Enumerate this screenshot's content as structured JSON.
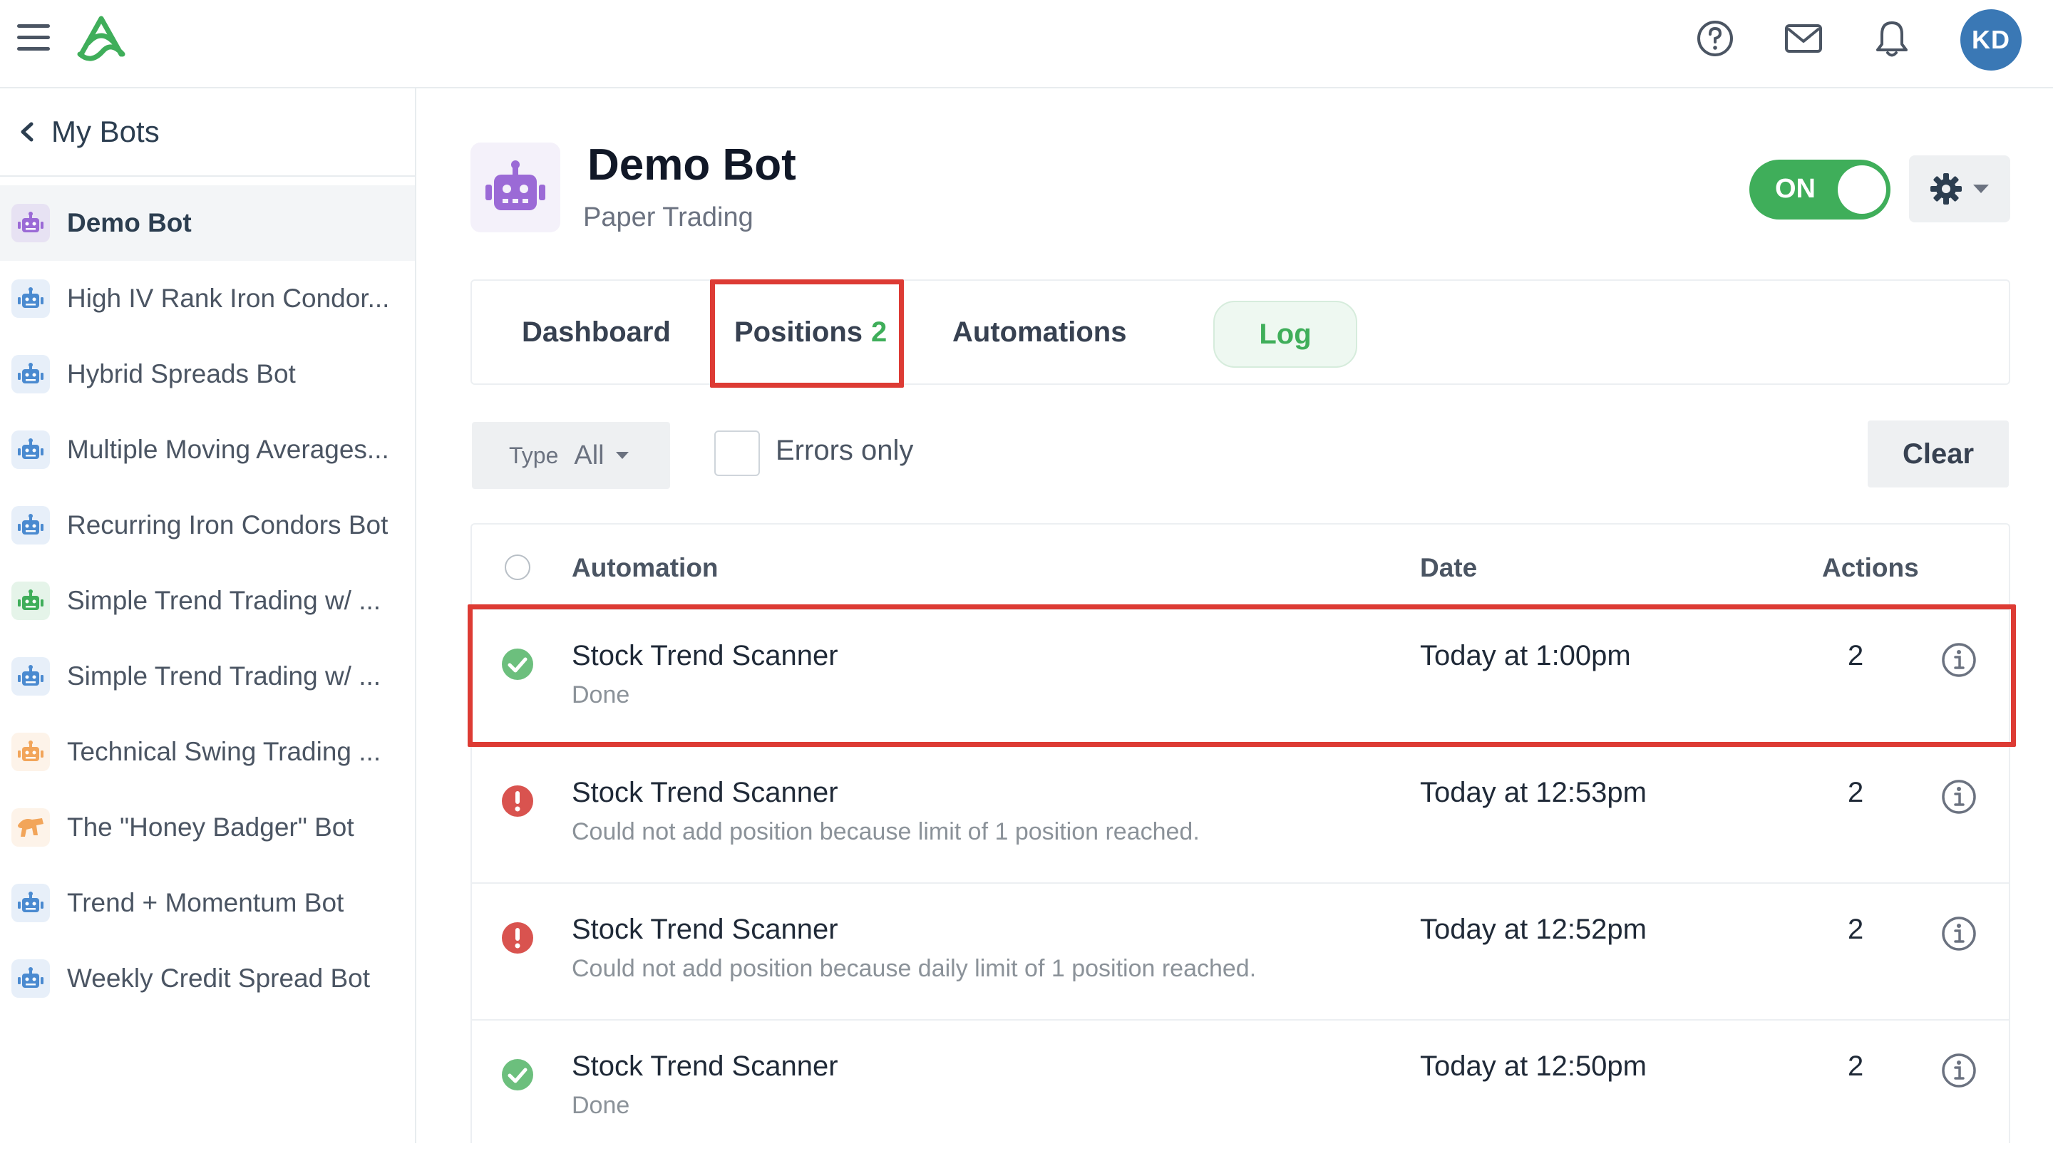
{
  "user": {
    "initials": "KD"
  },
  "sidebar": {
    "back_label": "My Bots",
    "items": [
      {
        "label": "Demo Bot",
        "color": "#9b6ad6",
        "icon": "robot-icon",
        "active": true
      },
      {
        "label": "High IV Rank Iron Condor...",
        "color": "#4a8ad0",
        "icon": "robot-icon"
      },
      {
        "label": "Hybrid Spreads Bot",
        "color": "#4a8ad0",
        "icon": "robot-icon"
      },
      {
        "label": "Multiple Moving Averages...",
        "color": "#4a8ad0",
        "icon": "robot-icon"
      },
      {
        "label": "Recurring Iron Condors Bot",
        "color": "#4a8ad0",
        "icon": "robot-icon"
      },
      {
        "label": "Simple Trend Trading w/ ...",
        "color": "#3fae5a",
        "icon": "robot-icon"
      },
      {
        "label": "Simple Trend Trading w/ ...",
        "color": "#4a8ad0",
        "icon": "robot-icon"
      },
      {
        "label": "Technical Swing Trading ...",
        "color": "#f2a55a",
        "icon": "robot-icon"
      },
      {
        "label": "The \"Honey Badger\" Bot",
        "color": "#f2a55a",
        "icon": "honey-badger-icon"
      },
      {
        "label": "Trend + Momentum Bot",
        "color": "#4a8ad0",
        "icon": "robot-icon"
      },
      {
        "label": "Weekly Credit Spread Bot",
        "color": "#4a8ad0",
        "icon": "robot-icon"
      }
    ]
  },
  "bot": {
    "title": "Demo Bot",
    "subtitle": "Paper Trading",
    "toggle_label": "ON"
  },
  "tabs": {
    "dashboard": "Dashboard",
    "positions": "Positions",
    "positions_count": "2",
    "automations": "Automations",
    "log": "Log"
  },
  "filters": {
    "type_label": "Type",
    "type_value": "All",
    "errors_only_label": "Errors only",
    "clear_label": "Clear"
  },
  "table": {
    "headers": {
      "automation": "Automation",
      "date": "Date",
      "actions": "Actions"
    },
    "rows": [
      {
        "name": "Stock Trend Scanner",
        "detail": "Done",
        "date": "Today at 1:00pm",
        "actions": "2",
        "status": "success"
      },
      {
        "name": "Stock Trend Scanner",
        "detail": "Could not add position because limit of 1 position reached.",
        "date": "Today at 12:53pm",
        "actions": "2",
        "status": "error"
      },
      {
        "name": "Stock Trend Scanner",
        "detail": "Could not add position because daily limit of 1 position reached.",
        "date": "Today at 12:52pm",
        "actions": "2",
        "status": "error"
      },
      {
        "name": "Stock Trend Scanner",
        "detail": "Done",
        "date": "Today at 12:50pm",
        "actions": "2",
        "status": "success"
      }
    ]
  },
  "colors": {
    "success": "#6cbf7d",
    "error": "#d9534f",
    "accent": "#3fae5a",
    "highlight": "#dd3b34"
  }
}
